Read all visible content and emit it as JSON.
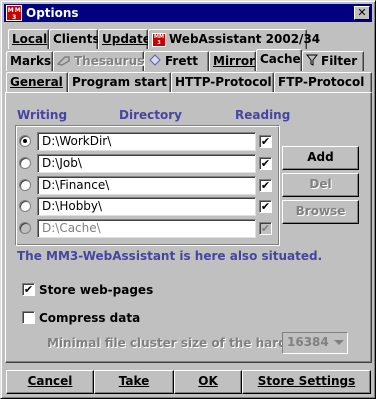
{
  "window": {
    "title": "Options",
    "close_glyph": "✕",
    "icon_text": "MM3"
  },
  "tabs": {
    "row1": [
      {
        "label": "Local"
      },
      {
        "label": "Clients"
      },
      {
        "label": "Update"
      },
      {
        "label": "WebAssistant 2002/34"
      }
    ],
    "row2": [
      {
        "label": "Marks"
      },
      {
        "label": "Thesaurus"
      },
      {
        "label": "Frett"
      },
      {
        "label": "Mirror"
      },
      {
        "label": "Cache"
      },
      {
        "label": "Filter"
      }
    ],
    "row3": [
      {
        "label": "General"
      },
      {
        "label": "Program start"
      },
      {
        "label": "HTTP-Protocol"
      },
      {
        "label": "FTP-Protocol"
      }
    ]
  },
  "headers": {
    "writing": "Writing",
    "directory": "Directory",
    "reading": "Reading"
  },
  "directories": [
    {
      "path": "D:\\WorkDir\\",
      "writing": true,
      "reading": true,
      "enabled": true
    },
    {
      "path": "D:\\Job\\",
      "writing": false,
      "reading": true,
      "enabled": true
    },
    {
      "path": "D:\\Finance\\",
      "writing": false,
      "reading": true,
      "enabled": true
    },
    {
      "path": "D:\\Hobby\\",
      "writing": false,
      "reading": true,
      "enabled": true
    },
    {
      "path": "D:\\Cache\\",
      "writing": false,
      "reading": true,
      "enabled": false
    }
  ],
  "side_buttons": {
    "add": "Add",
    "del": "Del",
    "browse": "Browse"
  },
  "info_text": "The MM3-WebAssistant is here also situated.",
  "options": {
    "store_web_pages": {
      "label": "Store web-pages",
      "checked": true
    },
    "compress_data": {
      "label": "Compress data",
      "checked": false
    },
    "cluster_label": "Minimal file cluster size of the hard disk.:",
    "cluster_value": "16384"
  },
  "check_glyph": "✔",
  "footer": {
    "cancel": "Cancel",
    "take": "Take",
    "ok": "OK",
    "store_settings": "Store Settings"
  },
  "colors": {
    "titlebar": "#000080",
    "accent_text": "#4646a0",
    "background": "#c0c0c0"
  }
}
